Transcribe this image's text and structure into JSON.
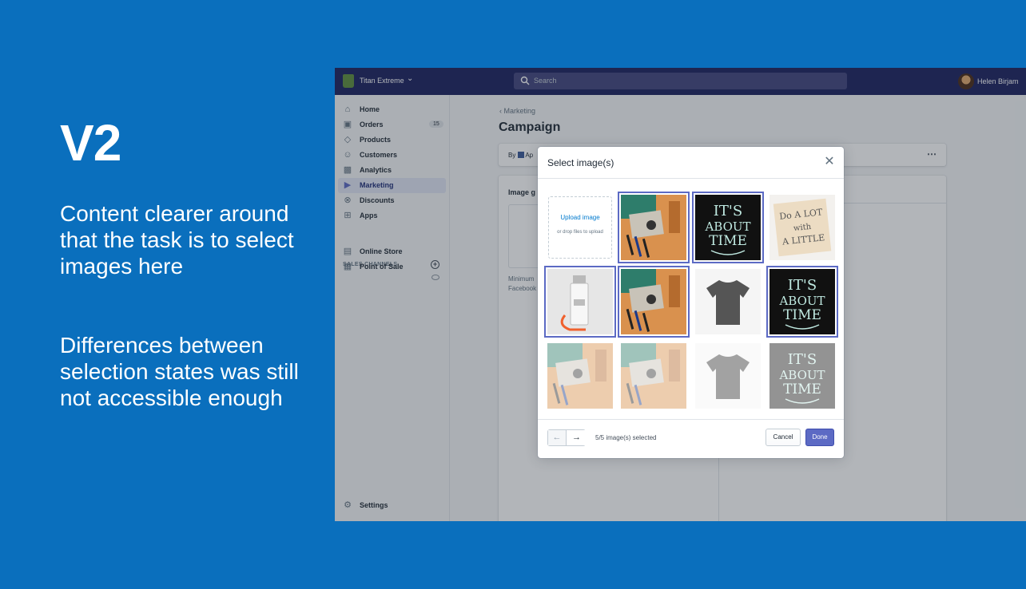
{
  "slide": {
    "title": "V2",
    "paragraph1": "Content clearer around that the task is to select images here",
    "paragraph2": "Differences between selection states was still not accessible enough"
  },
  "topbar": {
    "store_name": "Titan Extreme",
    "search_placeholder": "Search",
    "user_name": "Helen Birjam"
  },
  "sidebar": {
    "items": [
      {
        "label": "Home",
        "icon": "home-icon"
      },
      {
        "label": "Orders",
        "icon": "orders-icon",
        "badge": "15"
      },
      {
        "label": "Products",
        "icon": "tag-icon"
      },
      {
        "label": "Customers",
        "icon": "person-icon"
      },
      {
        "label": "Analytics",
        "icon": "bar-chart-icon"
      },
      {
        "label": "Marketing",
        "icon": "megaphone-icon",
        "active": true
      },
      {
        "label": "Discounts",
        "icon": "discount-icon"
      },
      {
        "label": "Apps",
        "icon": "apps-icon"
      }
    ],
    "channels_heading": "SALES CHANNELS",
    "channels": [
      {
        "label": "Online Store",
        "icon": "store-icon"
      },
      {
        "label": "Point of Sale",
        "icon": "pos-icon"
      }
    ],
    "settings_label": "Settings"
  },
  "page": {
    "breadcrumb": "Marketing",
    "title": "Campaign",
    "byline": "By",
    "byline_app": "Ap",
    "image_label": "Image g",
    "minimum_text": "Minimum Facebook"
  },
  "modal": {
    "title": "Select image(s)",
    "upload_link": "Upload image",
    "upload_hint": "or drop files to upload",
    "selection_status": "5/5 image(s) selected",
    "cancel_label": "Cancel",
    "done_label": "Done",
    "tiles": [
      {
        "name": "desk-flatlay",
        "selected": true,
        "faded": false
      },
      {
        "name": "its-about-time-poster",
        "selected": true,
        "faded": false
      },
      {
        "name": "do-a-lot-with-a-little-print",
        "selected": false,
        "faded": false
      },
      {
        "name": "bottle-product",
        "selected": true,
        "faded": false
      },
      {
        "name": "desk-flatlay",
        "selected": true,
        "faded": false
      },
      {
        "name": "black-tshirt",
        "selected": false,
        "faded": false
      },
      {
        "name": "its-about-time-poster",
        "selected": true,
        "faded": false
      },
      {
        "name": "desk-flatlay",
        "selected": false,
        "faded": true
      },
      {
        "name": "desk-flatlay",
        "selected": false,
        "faded": true
      },
      {
        "name": "black-tshirt",
        "selected": false,
        "faded": true
      },
      {
        "name": "its-about-time-poster",
        "selected": false,
        "faded": true
      }
    ],
    "poster_text": [
      "IT'S",
      "ABOUT",
      "TIME"
    ],
    "print_text": [
      "Do A LOT",
      "with",
      "A LITTLE"
    ]
  },
  "colors": {
    "slide_bg": "#0a6fbd",
    "topbar": "#1c2260",
    "accent": "#5c6ac4",
    "link": "#007ace"
  }
}
